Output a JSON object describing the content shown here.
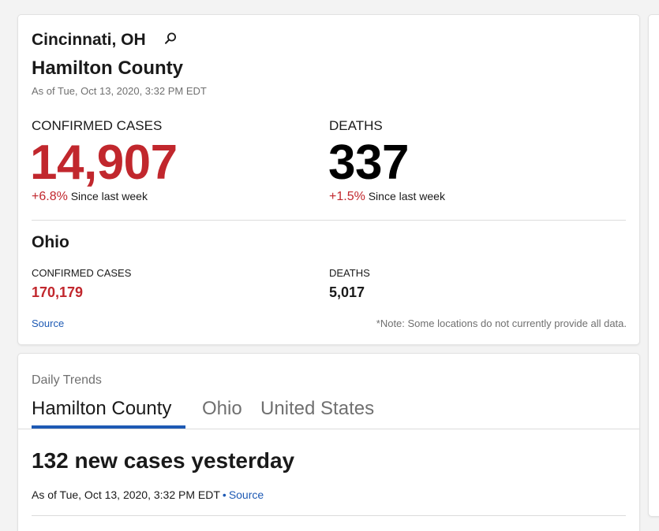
{
  "summary": {
    "location": "Cincinnati, OH",
    "search_icon": "search-icon",
    "county": "Hamilton County",
    "as_of": "As of Tue, Oct 13, 2020, 3:32 PM EDT",
    "cases": {
      "label": "CONFIRMED CASES",
      "value": "14,907",
      "change": "+6.8%",
      "change_text": "Since last week"
    },
    "deaths": {
      "label": "DEATHS",
      "value": "337",
      "change": "+1.5%",
      "change_text": "Since last week"
    },
    "state": {
      "name": "Ohio",
      "cases_label": "CONFIRMED CASES",
      "cases_value": "170,179",
      "deaths_label": "DEATHS",
      "deaths_value": "5,017"
    },
    "source_link": "Source",
    "note": "*Note: Some locations do not currently provide all data."
  },
  "trends": {
    "label": "Daily Trends",
    "tabs": [
      "Hamilton County",
      "Ohio",
      "United States"
    ],
    "selected_tab": "Hamilton County",
    "headline": "132 new cases yesterday",
    "as_of": "As of Tue, Oct 13, 2020, 3:32 PM EDT",
    "separator": "•",
    "source_link": "Source"
  },
  "colors": {
    "cases_red": "#c1272d",
    "link_blue": "#1e5ab4",
    "muted_gray": "#707070"
  }
}
